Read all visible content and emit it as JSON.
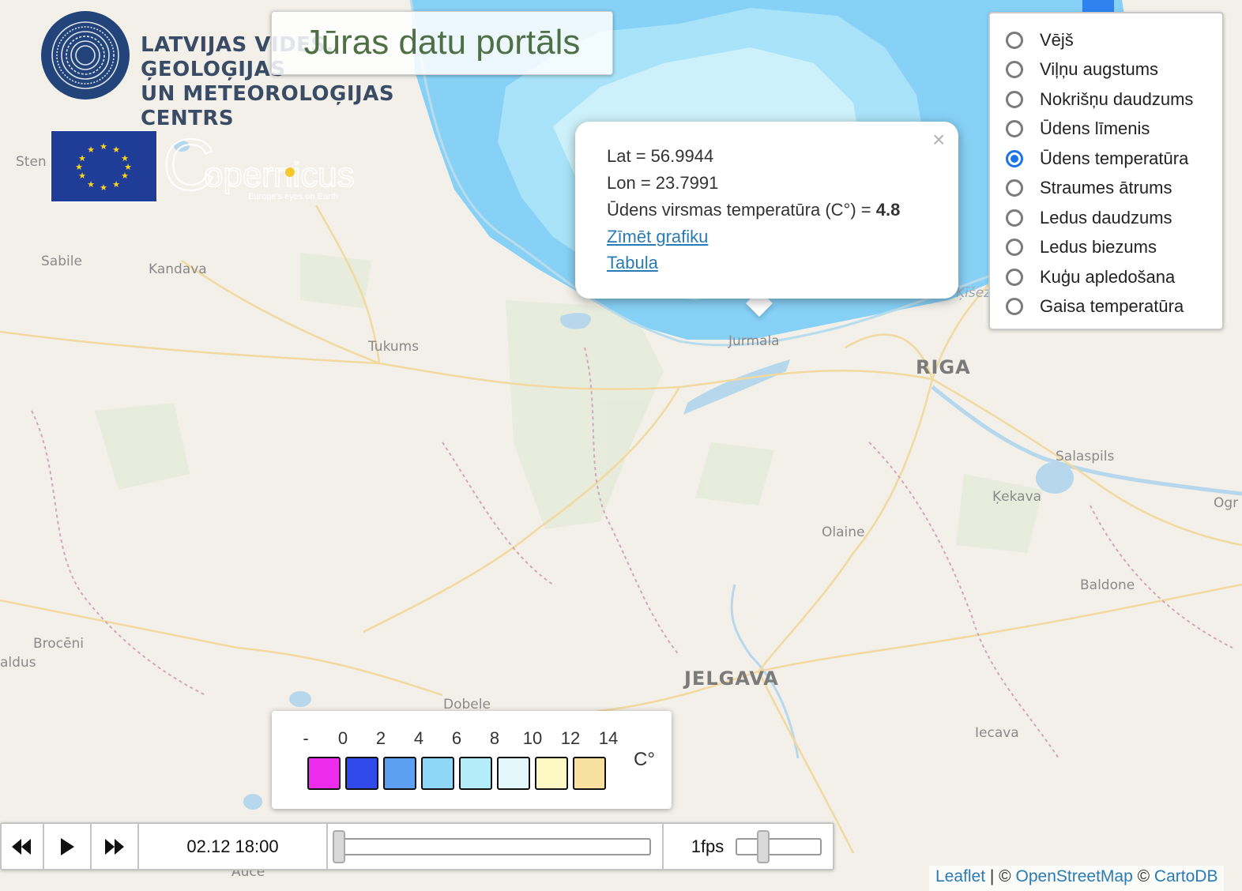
{
  "header": {
    "portal_title": "Jūras datu portāls",
    "lvgmc_line1": "LATVIJAS VIDES, ĢEOLOĢIJAS",
    "lvgmc_line2": "UN METEOROLOĢIJAS CENTRS",
    "copernicus_name": "opernicus",
    "copernicus_letter": "C",
    "copernicus_tagline": "Europe's eyes on Earth"
  },
  "map": {
    "places": [
      {
        "id": "sten",
        "name": "Sten"
      },
      {
        "id": "sabile",
        "name": "Sabile"
      },
      {
        "id": "kandava",
        "name": "Kandava"
      },
      {
        "id": "tukums",
        "name": "Tukums"
      },
      {
        "id": "jurmala",
        "name": "Jurmala"
      },
      {
        "id": "riga",
        "name": "RIGA"
      },
      {
        "id": "kisez",
        "name": "Ķīšez"
      },
      {
        "id": "salaspils",
        "name": "Salaspils"
      },
      {
        "id": "kekava",
        "name": "Ķekava"
      },
      {
        "id": "ogr",
        "name": "Ogr"
      },
      {
        "id": "olaine",
        "name": "Olaine"
      },
      {
        "id": "baldone",
        "name": "Baldone"
      },
      {
        "id": "broceni",
        "name": "Brocēni"
      },
      {
        "id": "saldus",
        "name": "aldus"
      },
      {
        "id": "jelgava",
        "name": "JELGAVA"
      },
      {
        "id": "dobele",
        "name": "Dobele"
      },
      {
        "id": "iecava",
        "name": "Iecava"
      },
      {
        "id": "auce",
        "name": "Auce"
      }
    ],
    "colors": {
      "land": "#f2f0e9",
      "sea_deep": "#87d1f7",
      "sea_mid": "#a8e3f9",
      "sea_light": "#cdf1fb",
      "sea_blue": "#2f82f0"
    }
  },
  "layers": {
    "selected": "Ūdens temperatūra",
    "items": [
      {
        "label": "Vējš",
        "checked": false
      },
      {
        "label": "Viļņu augstums",
        "checked": false
      },
      {
        "label": "Nokrišņu daudzums",
        "checked": false
      },
      {
        "label": "Ūdens līmenis",
        "checked": false
      },
      {
        "label": "Ūdens temperatūra",
        "checked": true
      },
      {
        "label": "Straumes ātrums",
        "checked": false
      },
      {
        "label": "Ledus daudzums",
        "checked": false
      },
      {
        "label": "Ledus biezums",
        "checked": false
      },
      {
        "label": "Kuģu apledošana",
        "checked": false
      },
      {
        "label": "Gaisa temperatūra",
        "checked": false
      }
    ]
  },
  "popup": {
    "lat": "Lat = 56.9944",
    "lon": "Lon = 23.7991",
    "temp_label": "Ūdens virsmas temperatūra (C°) = ",
    "temp_value": "4.8",
    "link_chart": "Zīmēt grafiku",
    "link_table": "Tabula",
    "close": "×"
  },
  "legend": {
    "ticks": [
      "-",
      "0",
      "2",
      "4",
      "6",
      "8",
      "10",
      "12",
      "14"
    ],
    "colors": [
      "#ee2cee",
      "#2f4ae8",
      "#5d9ff0",
      "#8fd7f7",
      "#b5ecfa",
      "#e4f8fb",
      "#fdf9c4",
      "#f8e0a0"
    ],
    "unit": "C°"
  },
  "timeline": {
    "time": "02.12 18:00",
    "fps": "1fps",
    "position": 0.0,
    "fps_level": 0.35
  },
  "attribution": {
    "leaflet": "Leaflet",
    "sep1": " | © ",
    "osm": "OpenStreetMap",
    "sep2": " © ",
    "carto": "CartoDB"
  }
}
